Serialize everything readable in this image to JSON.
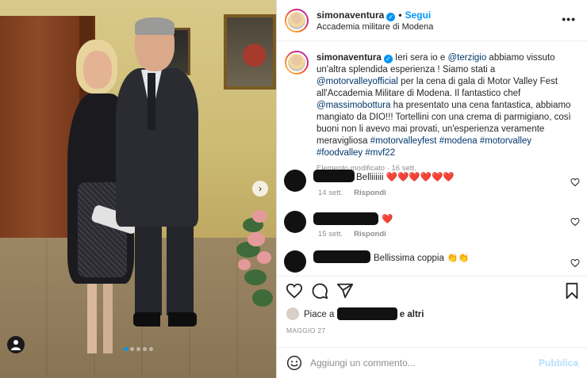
{
  "post": {
    "username": "simonaventura",
    "follow_label": "Segui",
    "separator": "•",
    "location": "Accademia militare di Modena",
    "more_icon": "more-horizontal-icon"
  },
  "caption": {
    "username": "simonaventura",
    "t1": " Ieri sera io e ",
    "m1": "@terzigio",
    "t2": " abbiamo vissuto un'altra splendida esperienza ! Siamo stati a ",
    "m2": "@motorvalleyofficial",
    "t3": " per la cena di gala di Motor Valley Fest all'Accademia Militare di Modena. Il fantastico chef ",
    "m3": "@massimobottura",
    "t4": " ha presentato una cena fantastica, abbiamo mangiato da DIO!!! Tortellini con una crema di parmigiano, così buoni non li avevo mai provati, un'esperienza veramente meravigliosa ",
    "h1": "#motorvalleyfest",
    "h2": "#modena",
    "h3": "#motorvalley",
    "h4": "#foodvalley",
    "h5": "#mvf22",
    "meta": "Elemento modificato · 16 sett."
  },
  "comments": [
    {
      "text": "Belliiiiii ❤️❤️❤️❤️❤️❤️",
      "time": "14 sett.",
      "reply": "Rispondi"
    },
    {
      "text": "❤️",
      "time": "15 sett.",
      "reply": "Rispondi"
    },
    {
      "text": "Bellissima coppia 👏👏"
    }
  ],
  "likes": {
    "prefix": "Piace a",
    "suffix": "e altri"
  },
  "date": "MAGGIO 27",
  "add_comment": {
    "placeholder": "Aggiungi un commento...",
    "publish_label": "Pubblica"
  },
  "carousel": {
    "slides": 5,
    "current": 1
  },
  "colors": {
    "accent": "#0095f6",
    "link": "#00376b",
    "muted": "#8e8e8e",
    "heart": "#ed4956"
  }
}
